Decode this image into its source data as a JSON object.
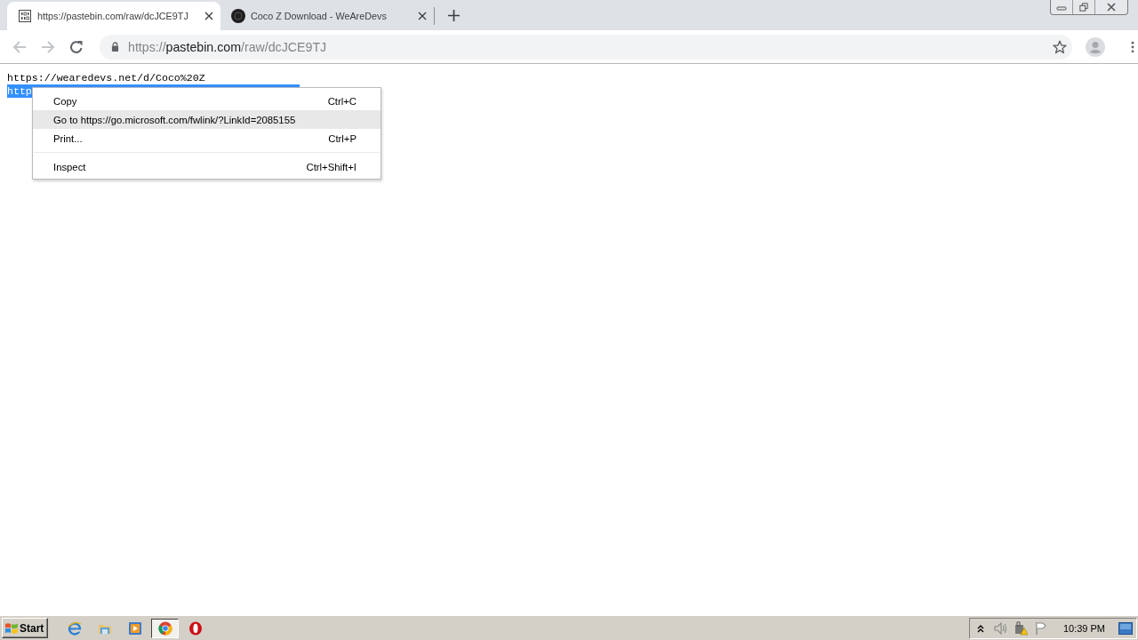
{
  "tabs": [
    {
      "kind": "document",
      "title": "https://pastebin.com/raw/dcJCE9TJ",
      "selected": true
    },
    {
      "kind": "site",
      "title": "Coco Z Download - WeAreDevs",
      "selected": false
    }
  ],
  "address_bar": {
    "scheme": "https://",
    "host": "pastebin.com",
    "path": "/raw/dcJCE9TJ"
  },
  "page": {
    "lines": [
      {
        "text": "https://wearedevs.net/d/Coco%20Z",
        "selected": false
      },
      {
        "text": "http",
        "selected": true
      }
    ]
  },
  "context_menu": {
    "items": [
      {
        "kind": "item",
        "label": "Copy",
        "shortcut": "Ctrl+C",
        "selected": false
      },
      {
        "kind": "item",
        "label": "Go to https://go.microsoft.com/fwlink/?LinkId=2085155",
        "selected": true
      },
      {
        "kind": "item",
        "label": "Print...",
        "shortcut": "Ctrl+P",
        "selected": false
      },
      {
        "kind": "separator"
      },
      {
        "kind": "item",
        "label": "Inspect",
        "shortcut": "Ctrl+Shift+I",
        "selected": false
      }
    ]
  },
  "taskbar": {
    "start_label": "Start",
    "apps": [
      {
        "kind": "globe",
        "selected": false
      },
      {
        "kind": "folder",
        "selected": false
      },
      {
        "kind": "player",
        "selected": false
      },
      {
        "kind": "wheel",
        "selected": true
      },
      {
        "kind": "ring",
        "selected": false
      }
    ],
    "clock": "10:39 PM"
  }
}
